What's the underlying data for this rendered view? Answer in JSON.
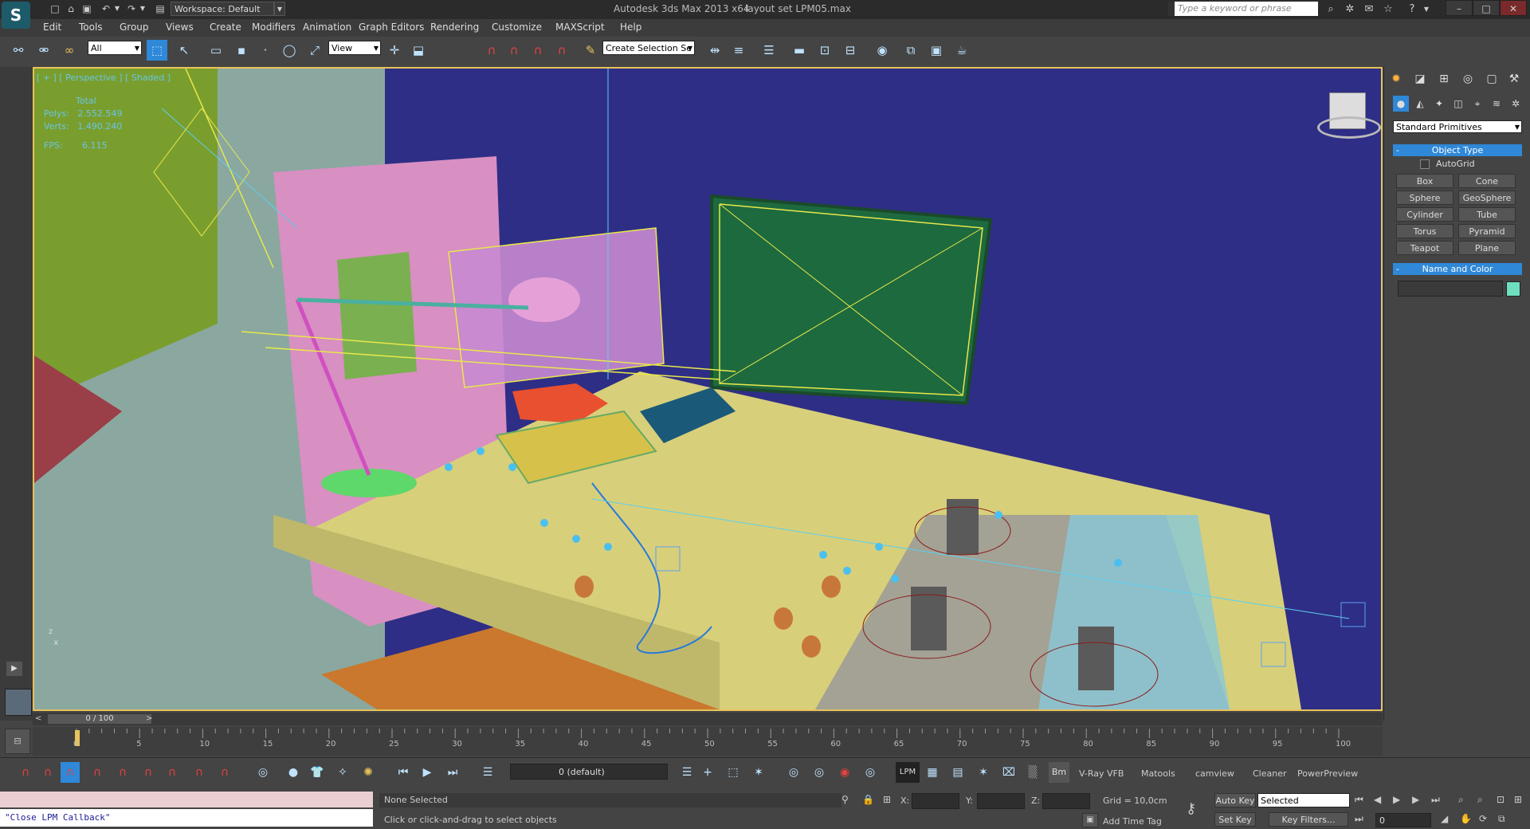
{
  "title_bar": {
    "workspace": "Workspace: Default",
    "app_title": "Autodesk 3ds Max  2013 x64",
    "file_name": "layout set LPM05.max",
    "search_placeholder": "Type a keyword or phrase"
  },
  "menu": [
    "Edit",
    "Tools",
    "Group",
    "Views",
    "Create",
    "Modifiers",
    "Animation",
    "Graph Editors",
    "Rendering",
    "Customize",
    "MAXScript",
    "Help"
  ],
  "main_toolbar": {
    "filter_value": "All",
    "ref_coord_value": "View",
    "selection_set_value": "Create Selection Se"
  },
  "viewport": {
    "label": "[ + ] [ Perspective ] [ Shaded ]",
    "stats_header": "Total",
    "polys_label": "Polys:",
    "polys_value": "2.552.549",
    "verts_label": "Verts:",
    "verts_value": "1.490.240",
    "fps_label": "FPS:",
    "fps_value": "6.115"
  },
  "command_panel": {
    "primitive_type": "Standard Primitives",
    "object_type_title": "Object Type",
    "autogrid_label": "AutoGrid",
    "object_buttons": [
      "Box",
      "Cone",
      "Sphere",
      "GeoSphere",
      "Cylinder",
      "Tube",
      "Torus",
      "Pyramid",
      "Teapot",
      "Plane"
    ],
    "name_color_title": "Name and Color",
    "color": "#6ee0c0"
  },
  "timeline": {
    "frame_display": "0 / 100",
    "ticks": [
      "0",
      "5",
      "10",
      "15",
      "20",
      "25",
      "30",
      "35",
      "40",
      "45",
      "50",
      "55",
      "60",
      "65",
      "70",
      "75",
      "80",
      "85",
      "90",
      "95",
      "100"
    ]
  },
  "bottom_toolbar": {
    "layer_value": "0 (default)",
    "plugins": [
      "LPM",
      "Bm",
      "V-Ray VFB",
      "Matools",
      "camview",
      "Cleaner",
      "PowerPreview"
    ]
  },
  "status": {
    "maxscript_output": "\"Close LPM Callback\"",
    "selection_status": "None Selected",
    "prompt": "Click or click-and-drag to select objects",
    "x_label": "X:",
    "y_label": "Y:",
    "z_label": "Z:",
    "grid": "Grid = 10,0cm",
    "add_time_tag": "Add Time Tag",
    "auto_key": "Auto Key",
    "set_key": "Set Key",
    "key_mode": "Selected",
    "key_filters": "Key Filters...",
    "current_frame": "0"
  }
}
